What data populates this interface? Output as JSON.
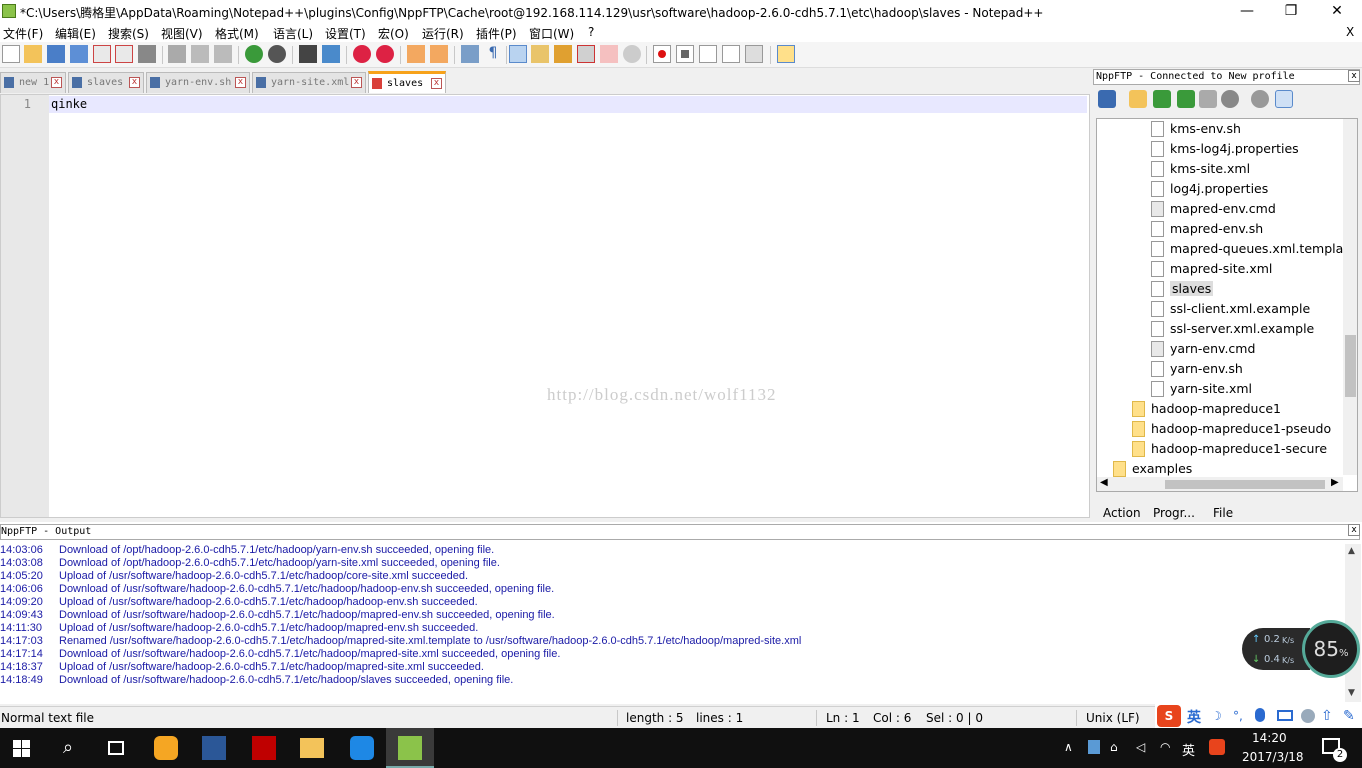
{
  "window": {
    "title": "*C:\\Users\\腾格里\\AppData\\Roaming\\Notepad++\\plugins\\Config\\NppFTP\\Cache\\root@192.168.114.129\\usr\\software\\hadoop-2.6.0-cdh5.7.1\\etc\\hadoop\\slaves - Notepad++",
    "minimize": "—",
    "maximize": "❐",
    "close": "✕",
    "doc_close": "X"
  },
  "menu": [
    "文件(F)",
    "编辑(E)",
    "搜索(S)",
    "视图(V)",
    "格式(M)",
    "语言(L)",
    "设置(T)",
    "宏(O)",
    "运行(R)",
    "插件(P)",
    "窗口(W)",
    "?"
  ],
  "tabs": [
    {
      "label": "new 1",
      "active": false
    },
    {
      "label": "slaves",
      "active": false
    },
    {
      "label": "yarn-env.sh",
      "active": false
    },
    {
      "label": "yarn-site.xml",
      "active": false
    },
    {
      "label": "slaves",
      "active": true
    }
  ],
  "tab_close": "x",
  "editor": {
    "line_number": "1",
    "content": "qinke",
    "watermark": "http://blog.csdn.net/wolf1132"
  },
  "ftp": {
    "header": "NppFTP - Connected to New profile",
    "close": "x",
    "tree": [
      {
        "name": "kms-env.sh",
        "type": "file",
        "depth": 2
      },
      {
        "name": "kms-log4j.properties",
        "type": "file",
        "depth": 2
      },
      {
        "name": "kms-site.xml",
        "type": "file",
        "depth": 2
      },
      {
        "name": "log4j.properties",
        "type": "file",
        "depth": 2
      },
      {
        "name": "mapred-env.cmd",
        "type": "cfg",
        "depth": 2
      },
      {
        "name": "mapred-env.sh",
        "type": "file",
        "depth": 2
      },
      {
        "name": "mapred-queues.xml.template",
        "type": "file",
        "depth": 2
      },
      {
        "name": "mapred-site.xml",
        "type": "file",
        "depth": 2
      },
      {
        "name": "slaves",
        "type": "file",
        "depth": 2,
        "selected": true
      },
      {
        "name": "ssl-client.xml.example",
        "type": "file",
        "depth": 2
      },
      {
        "name": "ssl-server.xml.example",
        "type": "file",
        "depth": 2
      },
      {
        "name": "yarn-env.cmd",
        "type": "cfg",
        "depth": 2
      },
      {
        "name": "yarn-env.sh",
        "type": "file",
        "depth": 2
      },
      {
        "name": "yarn-site.xml",
        "type": "file",
        "depth": 2
      },
      {
        "name": "hadoop-mapreduce1",
        "type": "folder",
        "depth": 1
      },
      {
        "name": "hadoop-mapreduce1-pseudo",
        "type": "folder",
        "depth": 1
      },
      {
        "name": "hadoop-mapreduce1-secure",
        "type": "folder",
        "depth": 1
      },
      {
        "name": "examples",
        "type": "folder",
        "depth": 0
      }
    ],
    "queue_headers": [
      "Action",
      "Progr...",
      "File"
    ]
  },
  "output": {
    "header": "NppFTP - Output",
    "close": "x",
    "lines": [
      {
        "time": "14:03:06",
        "msg": "Download of /opt/hadoop-2.6.0-cdh5.7.1/etc/hadoop/yarn-env.sh succeeded, opening file."
      },
      {
        "time": "14:03:08",
        "msg": "Download of /opt/hadoop-2.6.0-cdh5.7.1/etc/hadoop/yarn-site.xml succeeded, opening file."
      },
      {
        "time": "14:05:20",
        "msg": "Upload of /usr/software/hadoop-2.6.0-cdh5.7.1/etc/hadoop/core-site.xml succeeded."
      },
      {
        "time": "14:06:06",
        "msg": "Download of /usr/software/hadoop-2.6.0-cdh5.7.1/etc/hadoop/hadoop-env.sh succeeded, opening file."
      },
      {
        "time": "14:09:20",
        "msg": "Upload of /usr/software/hadoop-2.6.0-cdh5.7.1/etc/hadoop/hadoop-env.sh succeeded."
      },
      {
        "time": "14:09:43",
        "msg": "Download of /usr/software/hadoop-2.6.0-cdh5.7.1/etc/hadoop/mapred-env.sh succeeded, opening file."
      },
      {
        "time": "14:11:30",
        "msg": "Upload of /usr/software/hadoop-2.6.0-cdh5.7.1/etc/hadoop/mapred-env.sh succeeded."
      },
      {
        "time": "14:17:03",
        "msg": "Renamed /usr/software/hadoop-2.6.0-cdh5.7.1/etc/hadoop/mapred-site.xml.template to /usr/software/hadoop-2.6.0-cdh5.7.1/etc/hadoop/mapred-site.xml"
      },
      {
        "time": "14:17:14",
        "msg": "Download of /usr/software/hadoop-2.6.0-cdh5.7.1/etc/hadoop/mapred-site.xml succeeded, opening file."
      },
      {
        "time": "14:18:37",
        "msg": "Upload of /usr/software/hadoop-2.6.0-cdh5.7.1/etc/hadoop/mapred-site.xml succeeded."
      },
      {
        "time": "14:18:49",
        "msg": "Download of /usr/software/hadoop-2.6.0-cdh5.7.1/etc/hadoop/slaves succeeded, opening file."
      }
    ]
  },
  "net_widget": {
    "up": "0.2",
    "down": "0.4",
    "unit": "K/s",
    "percent": "85",
    "percent_unit": "%"
  },
  "status": {
    "filetype": "Normal text file",
    "length": "length : 5",
    "lines": "lines : 1",
    "ln": "Ln : 1",
    "col": "Col : 6",
    "sel": "Sel : 0 | 0",
    "eol": "Unix (LF)"
  },
  "ime": {
    "logo": "S",
    "lang": "英"
  },
  "taskbar": {
    "tray_lang": "英",
    "time": "14:20",
    "date": "2017/3/18",
    "notifications": "2"
  },
  "colors": {
    "accent_tab": "#f7a21a",
    "log_text": "#1a1aa6",
    "current_line": "#e8e8ff"
  }
}
